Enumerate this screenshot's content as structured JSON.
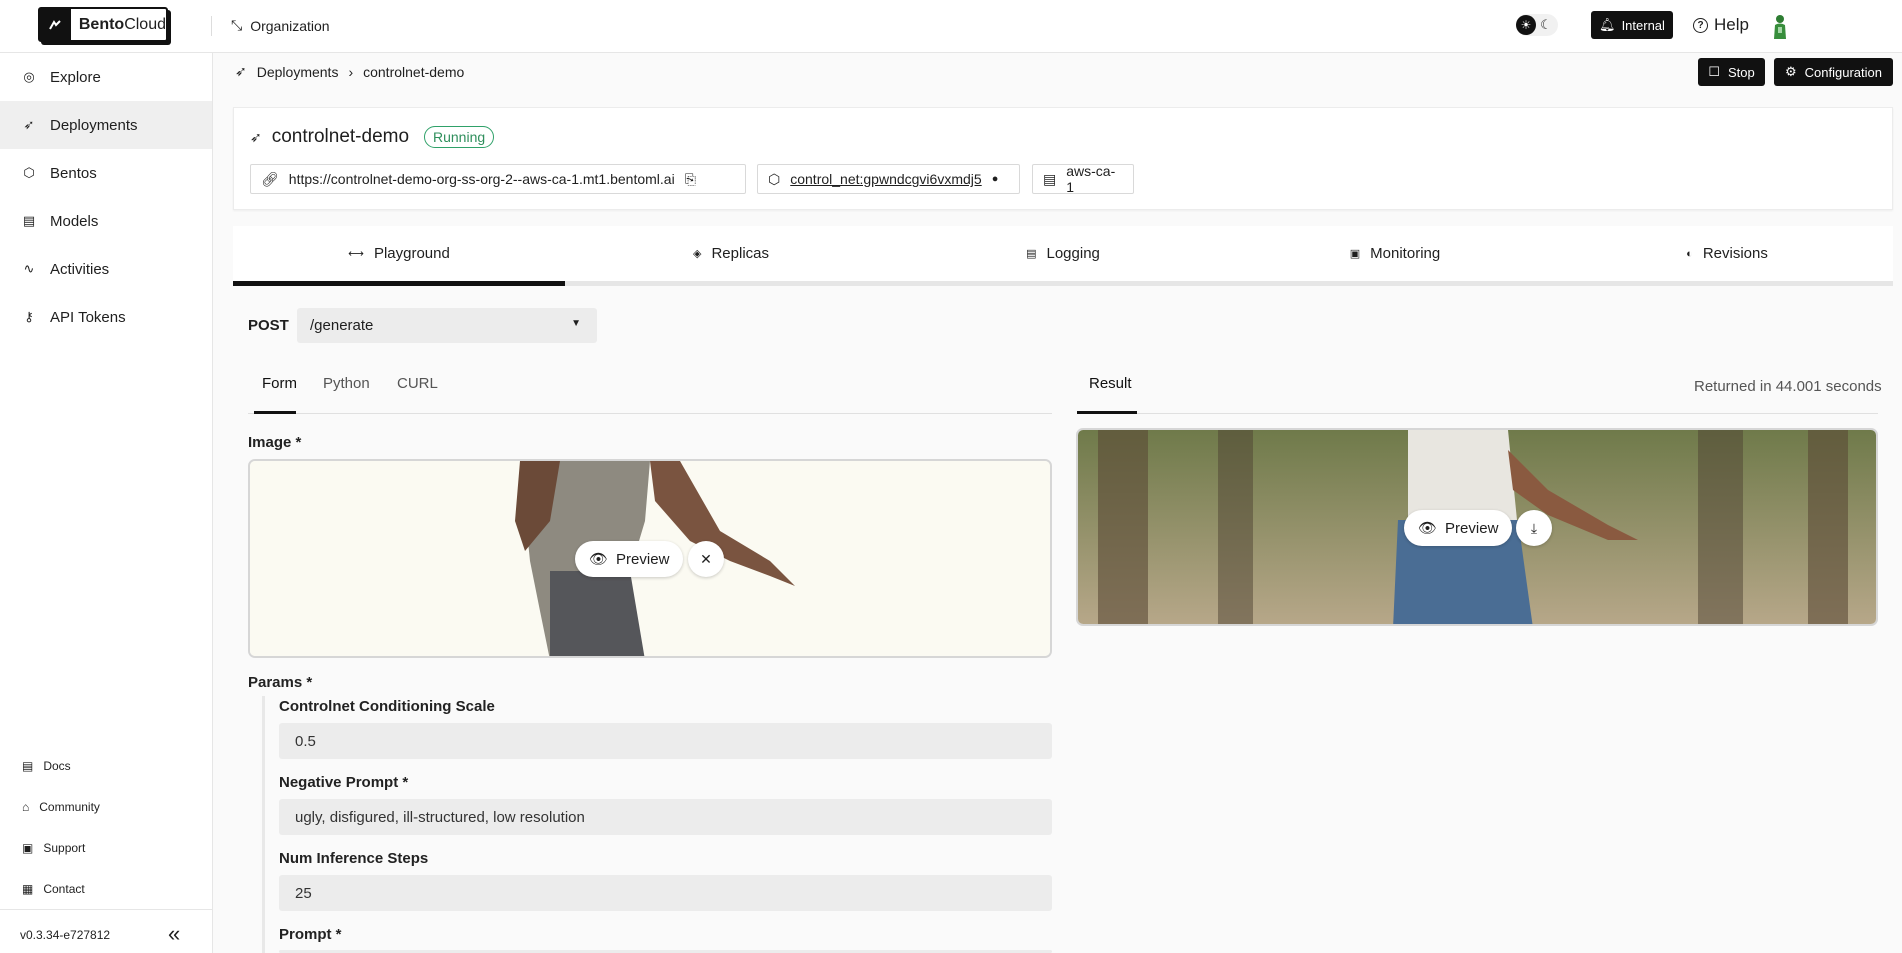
{
  "topbar": {
    "logo": {
      "bold": "Bento",
      "rest": "Cloud"
    },
    "org_label": "Organization",
    "internal_label": "Internal",
    "help_label": "Help"
  },
  "sidebar": {
    "items": [
      {
        "label": "Explore",
        "icon": "compass-icon"
      },
      {
        "label": "Deployments",
        "icon": "rocket-icon",
        "active": true
      },
      {
        "label": "Bentos",
        "icon": "box-icon"
      },
      {
        "label": "Models",
        "icon": "file-icon"
      },
      {
        "label": "Activities",
        "icon": "activity-icon"
      },
      {
        "label": "API Tokens",
        "icon": "key-icon"
      }
    ],
    "footer": [
      {
        "label": "Docs",
        "icon": "doc-icon"
      },
      {
        "label": "Community",
        "icon": "community-icon"
      },
      {
        "label": "Support",
        "icon": "support-icon"
      },
      {
        "label": "Contact",
        "icon": "contact-icon"
      }
    ],
    "version": "v0.3.34-e727812"
  },
  "breadcrumb": {
    "root": "Deployments",
    "current": "controlnet-demo"
  },
  "actions": {
    "stop_label": "Stop",
    "config_label": "Configuration"
  },
  "deployment": {
    "name": "controlnet-demo",
    "status": "Running",
    "url": "https://controlnet-demo-org-ss-org-2--aws-ca-1.mt1.bentoml.ai",
    "bento": "control_net:gpwndcgvi6vxmdj5",
    "cluster": "aws-ca-1"
  },
  "tabs": [
    {
      "label": "Playground",
      "active": true
    },
    {
      "label": "Replicas"
    },
    {
      "label": "Logging"
    },
    {
      "label": "Monitoring"
    },
    {
      "label": "Revisions"
    }
  ],
  "playground": {
    "method": "POST",
    "endpoint": "/generate",
    "input_tabs": [
      "Form",
      "Python",
      "CURL"
    ],
    "result_tab": "Result",
    "returned": "Returned in 44.001 seconds",
    "image_label": "Image *",
    "preview_label": "Preview",
    "params_label": "Params *",
    "fields": [
      {
        "label": "Controlnet Conditioning Scale",
        "value": "0.5"
      },
      {
        "label": "Negative Prompt *",
        "value": "ugly, disfigured, ill-structured, low resolution"
      },
      {
        "label": "Num Inference Steps",
        "value": "25"
      },
      {
        "label": "Prompt *",
        "value": ""
      }
    ]
  },
  "colors": {
    "running": "#2fa169",
    "dark_button": "#111111",
    "active_nav": "#efefef"
  }
}
